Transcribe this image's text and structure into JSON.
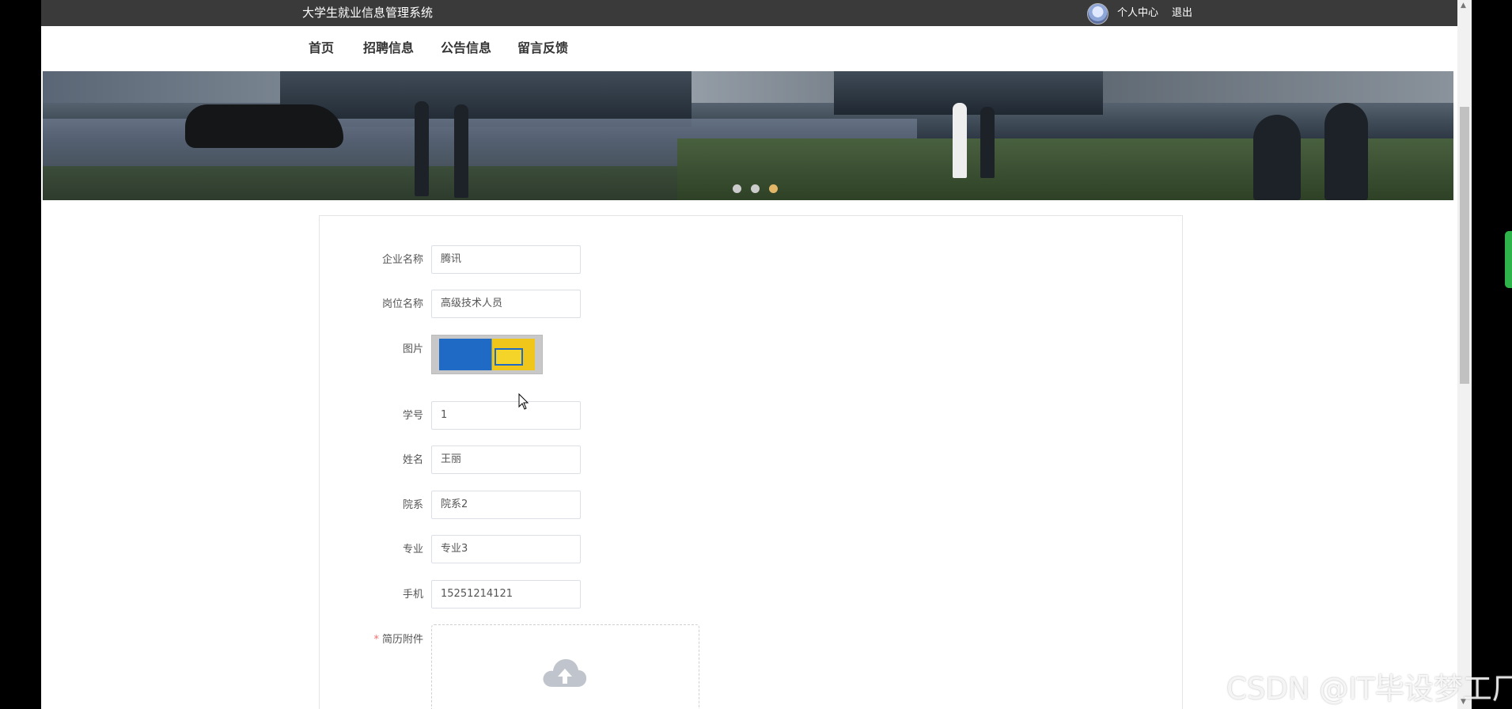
{
  "header": {
    "system_title": "大学生就业信息管理系统",
    "user_center": "个人中心",
    "logout": "退出"
  },
  "nav": {
    "items": [
      {
        "label": "首页"
      },
      {
        "label": "招聘信息"
      },
      {
        "label": "公告信息"
      },
      {
        "label": "留言反馈"
      }
    ]
  },
  "banner": {
    "slide_count": 3,
    "active_slide": 3
  },
  "form": {
    "company_name": {
      "label": "企业名称",
      "value": "腾讯"
    },
    "position_name": {
      "label": "岗位名称",
      "value": "高级技术人员"
    },
    "picture": {
      "label": "图片"
    },
    "student_id": {
      "label": "学号",
      "value": "1"
    },
    "name": {
      "label": "姓名",
      "value": "王丽"
    },
    "department": {
      "label": "院系",
      "value": "院系2"
    },
    "major": {
      "label": "专业",
      "value": "专业3"
    },
    "phone": {
      "label": "手机",
      "value": "15251214121"
    },
    "resume": {
      "label": "简历附件",
      "required_mark": "*"
    }
  },
  "watermark": "CSDN @IT毕设梦工厂",
  "colors": {
    "topbar": "#3a3a3a",
    "active_dot": "#e2b868",
    "required": "#f56c6c"
  }
}
